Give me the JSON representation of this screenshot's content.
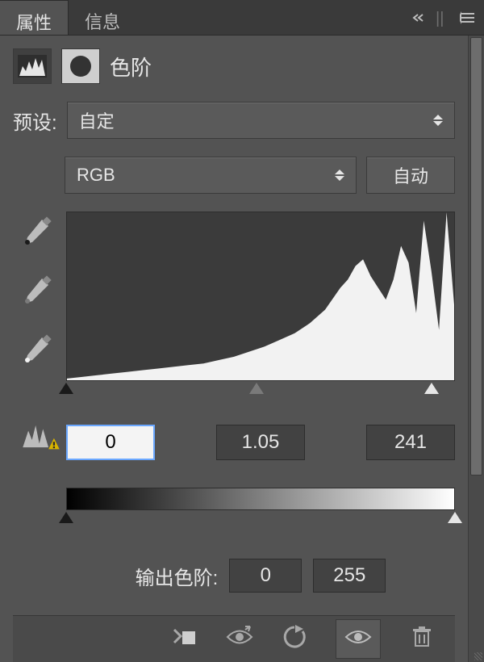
{
  "tabs": {
    "properties": "属性",
    "info": "信息"
  },
  "panel": {
    "title": "色阶",
    "preset_label": "预设:",
    "preset_value": "自定",
    "channel_value": "RGB",
    "auto_label": "自动",
    "output_label": "输出色阶:"
  },
  "input_levels": {
    "shadow": "0",
    "mid": "1.05",
    "highlight": "241"
  },
  "output_levels": {
    "low": "0",
    "high": "255"
  },
  "slider_positions_pct": {
    "shadow": 0,
    "mid": 49,
    "highlight": 94
  },
  "out_slider_positions_pct": {
    "low": 0,
    "high": 100
  },
  "chart_data": {
    "type": "area",
    "title": "",
    "xlabel": "",
    "ylabel": "",
    "xlim": [
      0,
      255
    ],
    "ylim": [
      0,
      100
    ],
    "x": [
      0,
      10,
      20,
      30,
      40,
      50,
      60,
      70,
      80,
      90,
      100,
      110,
      120,
      130,
      140,
      150,
      160,
      170,
      180,
      185,
      190,
      195,
      200,
      205,
      210,
      215,
      220,
      225,
      230,
      235,
      240,
      245,
      250,
      255
    ],
    "values": [
      1,
      2,
      3,
      4,
      5,
      6,
      7,
      8,
      9,
      10,
      12,
      14,
      17,
      20,
      24,
      28,
      34,
      42,
      55,
      60,
      68,
      72,
      62,
      55,
      48,
      60,
      80,
      70,
      40,
      95,
      65,
      30,
      100,
      45
    ]
  },
  "icons": {
    "levels_thumb": "levels-icon",
    "mask_thumb": "mask-icon",
    "eyedropper_black": "eyedropper-black-icon",
    "eyedropper_gray": "eyedropper-gray-icon",
    "eyedropper_white": "eyedropper-white-icon",
    "clip_warning": "clip-warning-icon",
    "clip_to_layer": "clip-to-layer-icon",
    "toggle_visibility": "toggle-previous-state-icon",
    "reset": "reset-icon",
    "visibility": "visibility-icon",
    "delete": "trash-icon",
    "collapse": "collapse-icon",
    "menu": "panel-menu-icon"
  },
  "colors": {
    "panel_bg": "#535353",
    "well_bg": "#3b3b3b",
    "text": "#e6e6e6"
  }
}
